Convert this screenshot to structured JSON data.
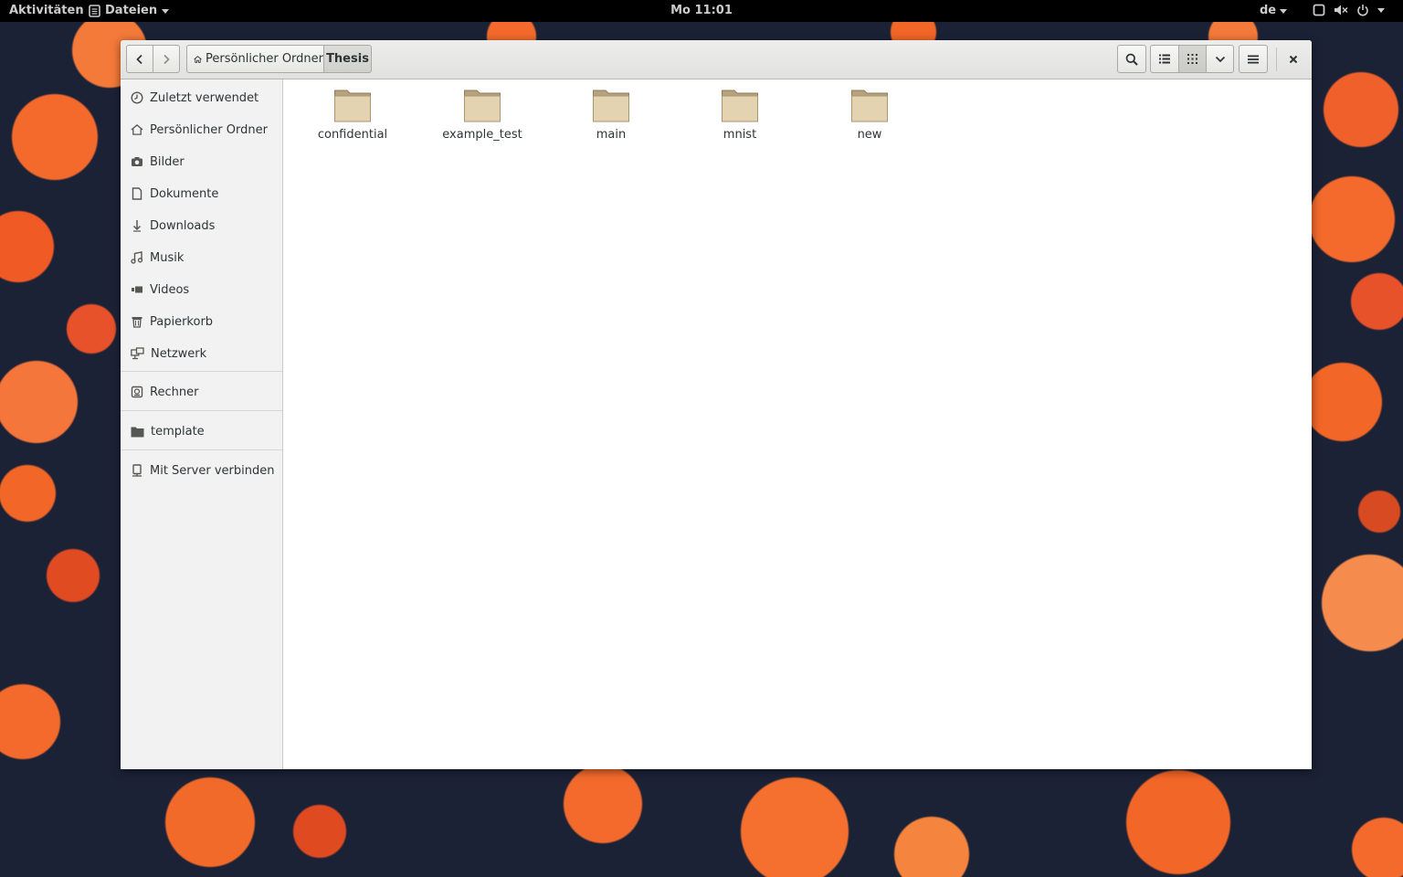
{
  "topbar": {
    "activities": "Aktivitäten",
    "app_menu": "Dateien",
    "clock": "Mo 11:01",
    "language": "de"
  },
  "headerbar": {
    "path_home": "Persönlicher Ordner",
    "path_current": "Thesis"
  },
  "sidebar": {
    "items": [
      {
        "label": "Zuletzt verwendet",
        "icon": "clock-icon"
      },
      {
        "label": "Persönlicher Ordner",
        "icon": "home-icon"
      },
      {
        "label": "Bilder",
        "icon": "camera-icon"
      },
      {
        "label": "Dokumente",
        "icon": "document-icon"
      },
      {
        "label": "Downloads",
        "icon": "download-icon"
      },
      {
        "label": "Musik",
        "icon": "music-icon"
      },
      {
        "label": "Videos",
        "icon": "video-icon"
      },
      {
        "label": "Papierkorb",
        "icon": "trash-icon"
      },
      {
        "label": "Netzwerk",
        "icon": "network-icon"
      }
    ],
    "devices": [
      {
        "label": "Rechner",
        "icon": "computer-icon"
      }
    ],
    "bookmarks": [
      {
        "label": "template",
        "icon": "folder-icon"
      }
    ],
    "connect": {
      "label": "Mit Server verbinden",
      "icon": "server-icon"
    }
  },
  "files": [
    {
      "name": "confidential",
      "icon": "folder-icon"
    },
    {
      "name": "example_test",
      "icon": "folder-icon"
    },
    {
      "name": "main",
      "icon": "folder-icon"
    },
    {
      "name": "mnist",
      "icon": "folder-icon"
    },
    {
      "name": "new",
      "icon": "folder-icon"
    }
  ],
  "colors": {
    "topbar_bg": "#000000",
    "topbar_text": "#cccccc",
    "folder_fill": "#e3d3b0",
    "folder_tab": "#b7a27e",
    "sidebar_bg": "#f2f2f2"
  }
}
